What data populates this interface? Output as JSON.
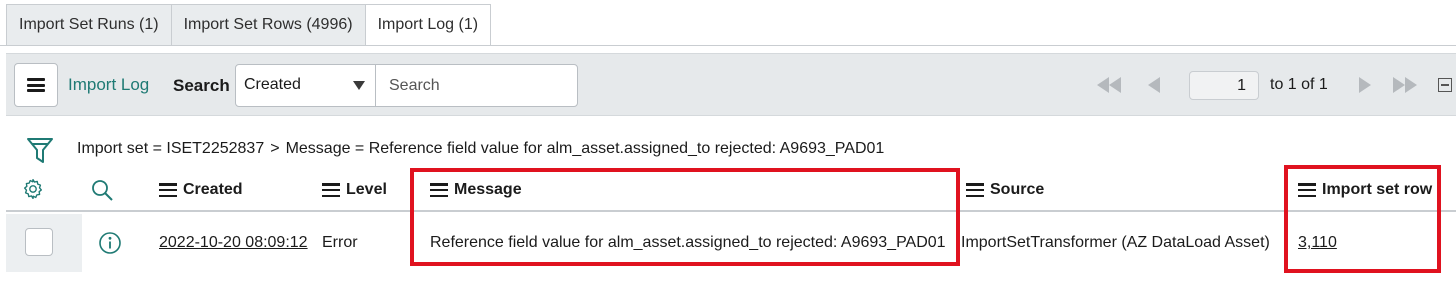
{
  "tabs": [
    {
      "label": "Import Set Runs (1)",
      "active": false
    },
    {
      "label": "Import Set Rows (4996)",
      "active": false
    },
    {
      "label": "Import Log (1)",
      "active": true
    }
  ],
  "toolbar": {
    "title": "Import Log",
    "search_label": "Search",
    "search_field_value": "Created",
    "search_placeholder": "Search",
    "page_value": "1",
    "page_of": "to 1 of 1"
  },
  "breadcrumb": {
    "part1": "Import set = ISET2252837",
    "separator": ">",
    "part2": "Message = Reference field value for alm_asset.assigned_to rejected: A9693_PAD01"
  },
  "table": {
    "columns": [
      "Created",
      "Level",
      "Message",
      "Source",
      "Import set row"
    ],
    "rows": [
      {
        "created": "2022-10-20 08:09:12",
        "level": "Error",
        "message": "Reference field value for alm_asset.assigned_to rejected: A9693_PAD01",
        "source": "ImportSetTransformer (AZ DataLoad Asset)",
        "import_set_row": "3,110"
      }
    ]
  },
  "colors": {
    "accent": "#1f7a74",
    "highlight": "#e0121f",
    "toolbar_bg": "#e6e9eb"
  },
  "icons": [
    "menu-icon",
    "caret-down-icon",
    "first-page-icon",
    "previous-page-icon",
    "next-page-icon",
    "last-page-icon",
    "collapse-icon",
    "filter-icon",
    "gear-icon",
    "search-icon",
    "info-icon"
  ]
}
